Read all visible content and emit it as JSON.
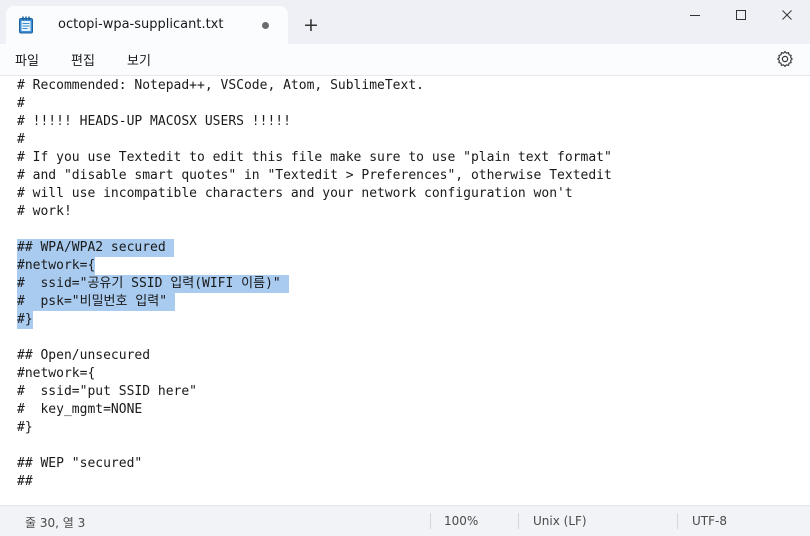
{
  "window": {
    "tab_title": "octopi-wpa-supplicant.txt",
    "unsaved_indicator": true,
    "new_tab_label": "+"
  },
  "menu": {
    "file": "파일",
    "edit": "편집",
    "view": "보기"
  },
  "editor": {
    "lines": [
      {
        "text": "# Recommended: Notepad++, VSCode, Atom, SublimeText.",
        "selected": false
      },
      {
        "text": "#",
        "selected": false
      },
      {
        "text": "# !!!!! HEADS-UP MACOSX USERS !!!!!",
        "selected": false
      },
      {
        "text": "#",
        "selected": false
      },
      {
        "text": "# If you use Textedit to edit this file make sure to use \"plain text format\"",
        "selected": false
      },
      {
        "text": "# and \"disable smart quotes\" in \"Textedit > Preferences\", otherwise Textedit",
        "selected": false
      },
      {
        "text": "# will use incompatible characters and your network configuration won't",
        "selected": false
      },
      {
        "text": "# work!",
        "selected": false
      },
      {
        "text": "",
        "selected": false
      },
      {
        "text": "## WPA/WPA2 secured ",
        "selected": true
      },
      {
        "text": "#network={",
        "selected": true
      },
      {
        "text": "#  ssid=\"공유기 SSID 입력(WIFI 이름)\" ",
        "selected": true
      },
      {
        "text": "#  psk=\"비밀번호 입력\" ",
        "selected": true
      },
      {
        "text": "#}",
        "selected": true
      },
      {
        "text": "",
        "selected": false
      },
      {
        "text": "## Open/unsecured",
        "selected": false
      },
      {
        "text": "#network={",
        "selected": false
      },
      {
        "text": "#  ssid=\"put SSID here\"",
        "selected": false
      },
      {
        "text": "#  key_mgmt=NONE",
        "selected": false
      },
      {
        "text": "#}",
        "selected": false
      },
      {
        "text": "",
        "selected": false
      },
      {
        "text": "## WEP \"secured\"",
        "selected": false
      },
      {
        "text": "##",
        "selected": false
      }
    ]
  },
  "status": {
    "position": "줄 30, 열 3",
    "zoom": "100%",
    "line_ending": "Unix (LF)",
    "encoding": "UTF-8"
  },
  "colors": {
    "selection": "#a9cbef",
    "titlebar": "#eef0f6",
    "statusbar": "#f2f3f7"
  }
}
